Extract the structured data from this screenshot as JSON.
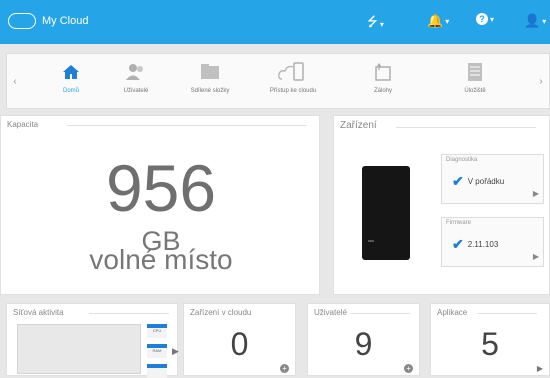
{
  "topbar": {
    "logo_text": "My Cloud",
    "icons": [
      "usb-icon",
      "bell-icon",
      "help-icon",
      "user-icon"
    ],
    "caret": "▾"
  },
  "nav": {
    "items": [
      {
        "label": "Domů",
        "icon": "home-icon",
        "active": true
      },
      {
        "label": "Uživatelé",
        "icon": "users-icon"
      },
      {
        "label": "Sdílené složky",
        "icon": "folder-icon"
      },
      {
        "label": "Přístup ke cloudu",
        "icon": "cloud-device-icon"
      },
      {
        "label": "Zálohy",
        "icon": "backup-icon"
      },
      {
        "label": "Úložiště",
        "icon": "storage-icon"
      }
    ]
  },
  "capacity": {
    "title": "Kapacita",
    "value": "956",
    "unit": "GB",
    "label": "volné místo"
  },
  "device": {
    "title": "Zařízení",
    "diagnostics": {
      "title": "Diagnostika",
      "value": "V pořádku"
    },
    "firmware": {
      "title": "Firmware",
      "value": "2.11.103"
    }
  },
  "network": {
    "title": "Síťová aktivita",
    "bars": [
      "CPU",
      "RAM",
      ""
    ]
  },
  "stats": [
    {
      "title": "Zařízení v cloudu",
      "value": "0"
    },
    {
      "title": "Uživatelé",
      "value": "9"
    },
    {
      "title": "Aplikace",
      "value": "5"
    }
  ],
  "colors": {
    "accent": "#26a4e8",
    "check": "#1f7fd8"
  }
}
